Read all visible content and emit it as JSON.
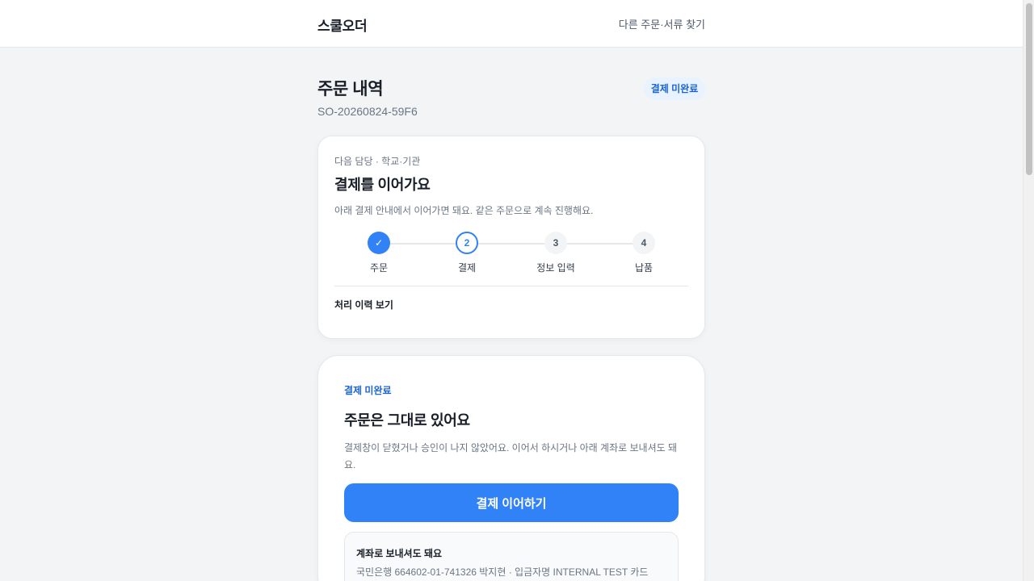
{
  "header": {
    "brand": "스쿨오더",
    "find_link": "다른 주문·서류 찾기"
  },
  "order": {
    "title": "주문 내역",
    "id": "SO-20260824-59F6",
    "status_badge": "결제 미완료"
  },
  "progress_card": {
    "eyebrow": "다음 담당 · 학교·기관",
    "heading": "결제를 이어가요",
    "description": "아래 결제 안내에서 이어가면 돼요. 같은 주문으로 계속 진행해요.",
    "steps": [
      {
        "number": "✓",
        "label": "주문",
        "state": "done"
      },
      {
        "number": "2",
        "label": "결제",
        "state": "current"
      },
      {
        "number": "3",
        "label": "정보 입력",
        "state": "todo"
      },
      {
        "number": "4",
        "label": "납품",
        "state": "todo"
      }
    ],
    "history_link": "처리 이력 보기"
  },
  "payment_card": {
    "eyebrow": "결제 미완료",
    "heading": "주문은 그대로 있어요",
    "description": "결제창이 닫혔거나 승인이 나지 않았어요. 이어서 하시거나 아래 계좌로 보내셔도 돼요.",
    "pay_button": "결제 이어하기",
    "bank": {
      "title": "계좌로 보내셔도 돼요",
      "info": "국민은행 664602-01-741326 박지현 · 입금자명 INTERNAL TEST 카드"
    }
  },
  "colors": {
    "accent": "#3182f6",
    "accent_text": "#1b64da",
    "badge_bg": "#e8f3ff",
    "page_bg": "#f2f4f6"
  }
}
